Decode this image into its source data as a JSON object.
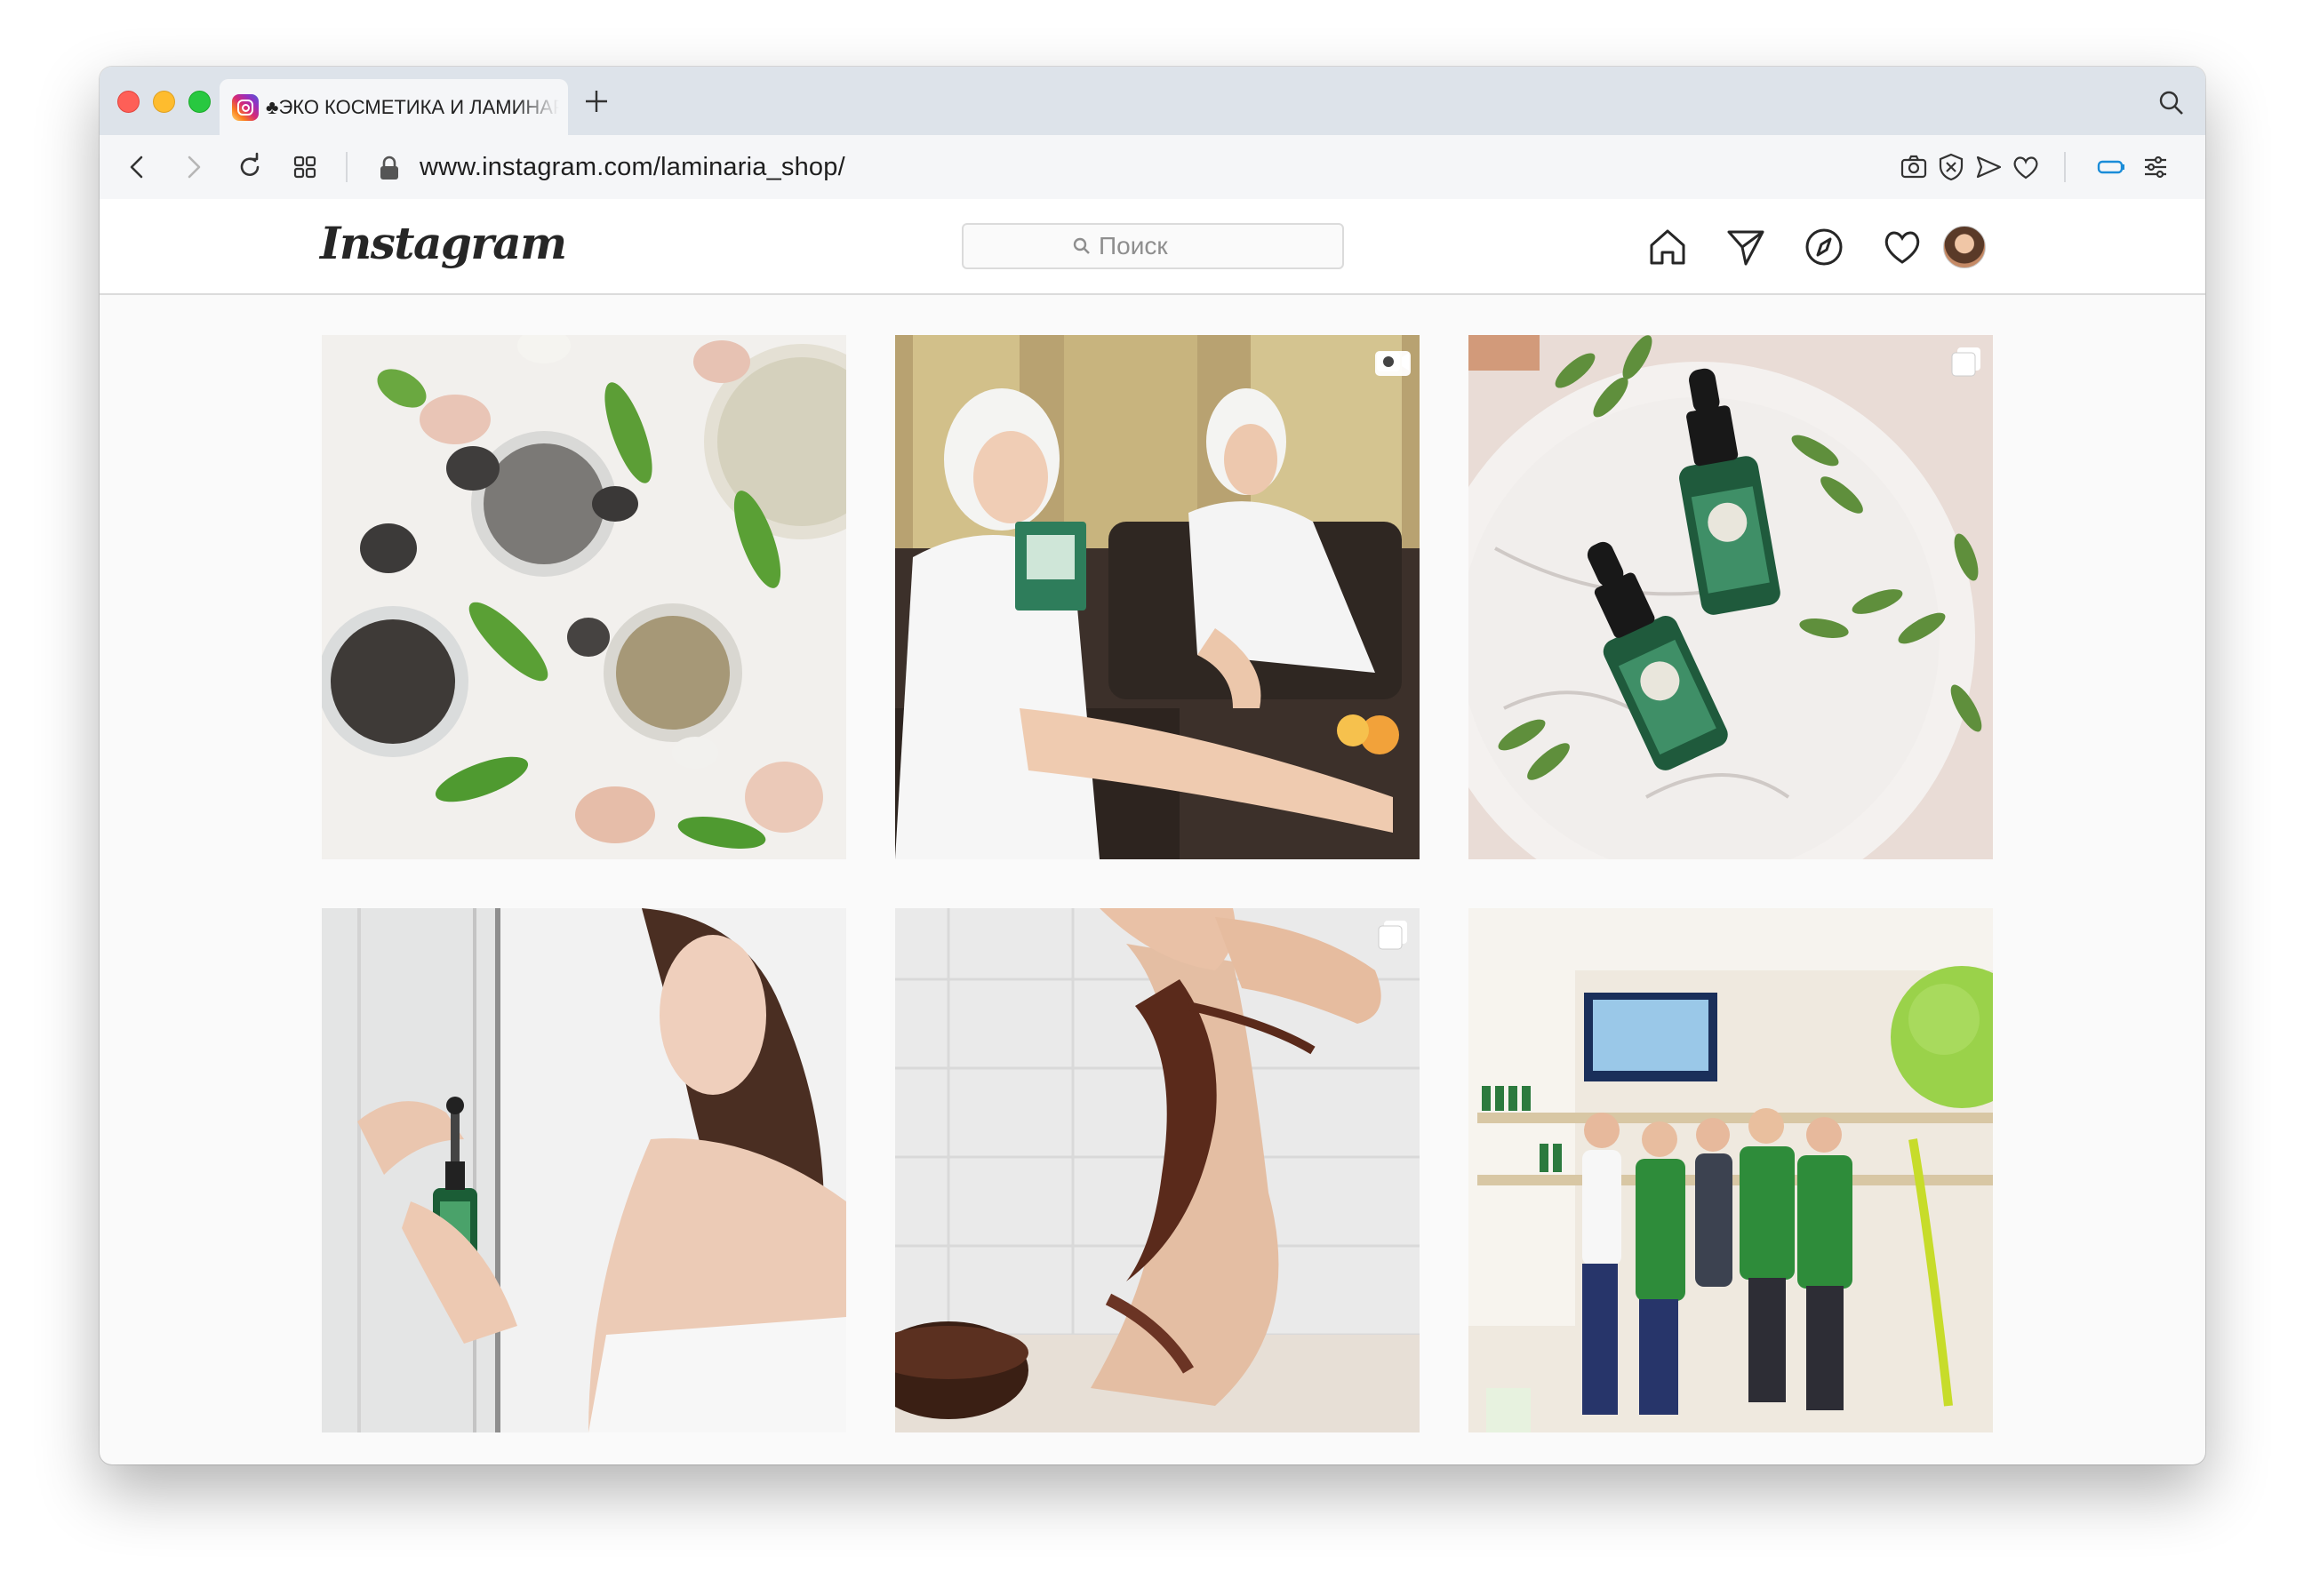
{
  "browser": {
    "tab_title": "♣ЭКО КОСМЕТИКА И ЛАМИНАРИЯ",
    "url": "www.instagram.com/laminaria_shop/"
  },
  "instagram": {
    "logo": "Instagram",
    "search_placeholder": "Поиск",
    "nav_icons": [
      "home-icon",
      "direct-icon",
      "explore-icon",
      "activity-heart-icon",
      "profile-avatar"
    ]
  },
  "posts": [
    {
      "subject": "clay powders, lava stones, shells and leaves flatlay",
      "badge": "none"
    },
    {
      "subject": "two women in white bathrobes and towels with face mask pack",
      "badge": "video"
    },
    {
      "subject": "two green dropper bottles on marble plate with olive branches",
      "badge": "carousel"
    },
    {
      "subject": "woman holding green dropper serum bottle",
      "badge": "none"
    },
    {
      "subject": "hands applying chocolate wrap on leg",
      "badge": "carousel"
    },
    {
      "subject": "Miss Laminaria exhibition booth team in green aprons",
      "badge": "none"
    }
  ],
  "colors": {
    "tabstrip": "#dde3ea",
    "page_bg": "#fafafa",
    "ig_text": "#262626",
    "border": "#dbdbdb"
  }
}
